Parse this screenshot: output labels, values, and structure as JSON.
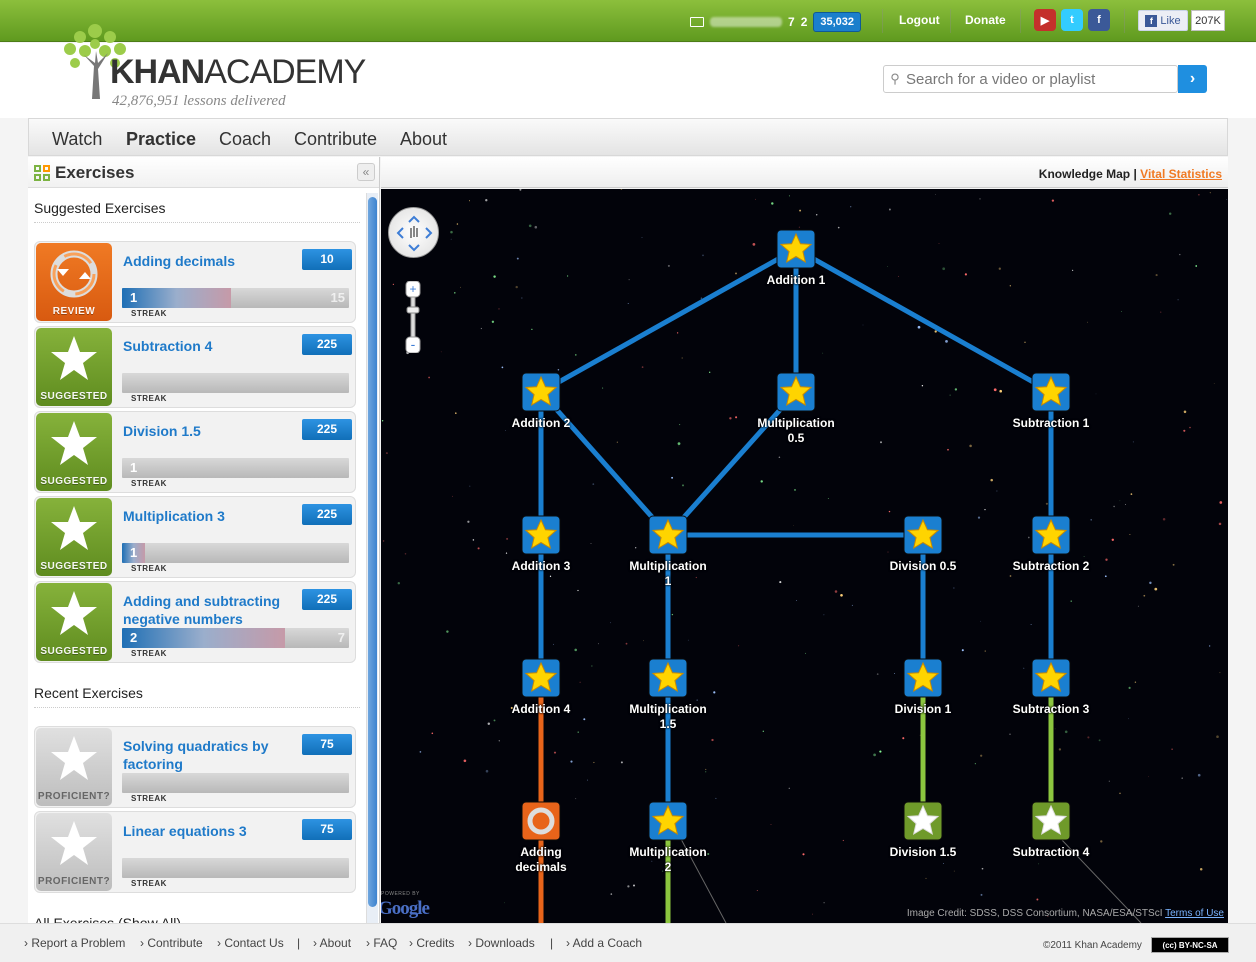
{
  "topbar": {
    "points": "35,032",
    "badges_gold": "7",
    "badges_silver": "2",
    "logout": "Logout",
    "donate": "Donate",
    "like": "Like",
    "like_count": "207K"
  },
  "header": {
    "logo_bold": "KHAN",
    "logo_light": "ACADEMY",
    "lessons": "42,876,951 lessons delivered",
    "search_placeholder": "Search for a video or playlist"
  },
  "nav": {
    "items": [
      "Watch",
      "Practice",
      "Coach",
      "Contribute",
      "About"
    ],
    "active": "Practice"
  },
  "sidebar": {
    "title": "Exercises",
    "suggested_title": "Suggested Exercises",
    "recent_title": "Recent Exercises",
    "all_title": "All Exercises (Show All)",
    "streak_label": "STREAK",
    "suggested": [
      {
        "name": "Adding decimals",
        "points": "10",
        "streak": "1",
        "goal": "15",
        "status": "REVIEW",
        "progress": 0.48
      },
      {
        "name": "Subtraction 4",
        "points": "225",
        "streak": "",
        "goal": "",
        "status": "SUGGESTED",
        "progress": 0
      },
      {
        "name": "Division 1.5",
        "points": "225",
        "streak": "1",
        "goal": "",
        "status": "SUGGESTED",
        "progress": 0
      },
      {
        "name": "Multiplication 3",
        "points": "225",
        "streak": "1",
        "goal": "",
        "status": "SUGGESTED",
        "progress": 0.1
      },
      {
        "name": "Adding and subtracting negative numbers",
        "points": "225",
        "streak": "2",
        "goal": "7",
        "status": "SUGGESTED",
        "progress": 0.72
      }
    ],
    "recent": [
      {
        "name": "Solving quadratics by factoring",
        "points": "75",
        "status": "PROFICIENT?",
        "progress": 0
      },
      {
        "name": "Linear equations 3",
        "points": "75",
        "status": "PROFICIENT?",
        "progress": 0
      }
    ]
  },
  "map": {
    "knowledge_map": "Knowledge Map",
    "vital_statistics": "Vital Statistics",
    "credit": "Image Credit: SDSS, DSS Consortium, NASA/ESA/STScI",
    "terms": "Terms of Use",
    "powered_by": "POWERED BY",
    "google": "Google",
    "nodes": [
      {
        "id": "add1",
        "label": "Addition 1",
        "type": "blue"
      },
      {
        "id": "add2",
        "label": "Addition 2",
        "type": "blue"
      },
      {
        "id": "mul05",
        "label": "Multiplication 0.5",
        "type": "blue"
      },
      {
        "id": "sub1",
        "label": "Subtraction 1",
        "type": "blue"
      },
      {
        "id": "add3",
        "label": "Addition 3",
        "type": "blue"
      },
      {
        "id": "mul1",
        "label": "Multiplication 1",
        "type": "blue"
      },
      {
        "id": "div05",
        "label": "Division 0.5",
        "type": "blue"
      },
      {
        "id": "sub2",
        "label": "Subtraction 2",
        "type": "blue"
      },
      {
        "id": "add4",
        "label": "Addition 4",
        "type": "blue"
      },
      {
        "id": "mul15",
        "label": "Multiplication 1.5",
        "type": "blue"
      },
      {
        "id": "div1",
        "label": "Division 1",
        "type": "blue"
      },
      {
        "id": "sub3",
        "label": "Subtraction 3",
        "type": "blue"
      },
      {
        "id": "adddec",
        "label": "Adding decimals",
        "type": "review"
      },
      {
        "id": "mul2",
        "label": "Multiplication 2",
        "type": "blue"
      },
      {
        "id": "div15",
        "label": "Division 1.5",
        "type": "green"
      },
      {
        "id": "sub4",
        "label": "Subtraction 4",
        "type": "green"
      }
    ]
  },
  "footer": {
    "links": [
      "Report a Problem",
      "Contribute",
      "Contact Us",
      "About",
      "FAQ",
      "Credits",
      "Downloads",
      "Add a Coach"
    ],
    "copyright": "©2011 Khan Academy",
    "license": "BY-NC-SA"
  },
  "colors": {
    "accent_green": "#6aa52a",
    "link_blue": "#1f7ac9",
    "review_orange": "#e86a1a",
    "edge_blue": "#1a7fd0",
    "edge_green": "#8cc63f",
    "edge_orange": "#e8641a"
  }
}
